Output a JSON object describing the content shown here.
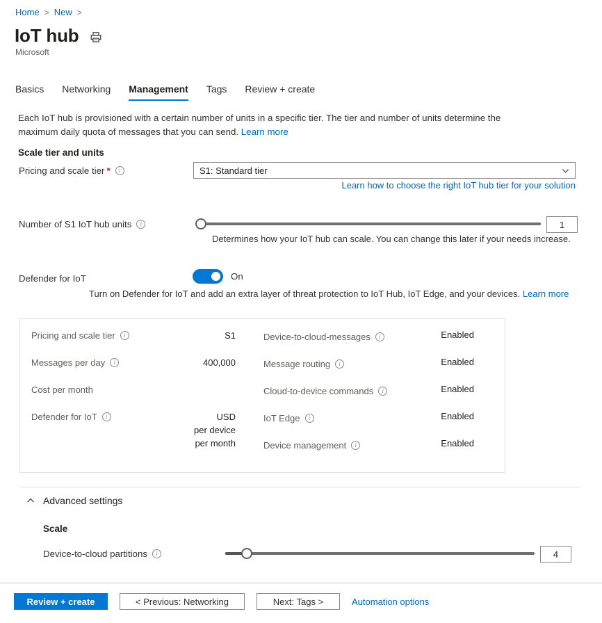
{
  "breadcrumb": {
    "items": [
      "Home",
      "New"
    ],
    "separator": ">"
  },
  "header": {
    "title": "IoT hub",
    "publisher": "Microsoft",
    "print_icon": "print-icon"
  },
  "tabs": [
    {
      "label": "Basics",
      "active": false
    },
    {
      "label": "Networking",
      "active": false
    },
    {
      "label": "Management",
      "active": true
    },
    {
      "label": "Tags",
      "active": false
    },
    {
      "label": "Review + create",
      "active": false
    }
  ],
  "intro": {
    "text": "Each IoT hub is provisioned with a certain number of units in a specific tier. The tier and number of units determine the maximum daily quota of messages that you can send. ",
    "link": "Learn more"
  },
  "scale_section": {
    "heading": "Scale tier and units",
    "pricing_tier": {
      "label": "Pricing and scale tier",
      "required_marker": "*",
      "info": "info-icon",
      "selected": "S1: Standard tier",
      "help_link": "Learn how to choose the right IoT hub tier for your solution"
    },
    "units": {
      "label": "Number of S1 IoT hub units",
      "info": "info-icon",
      "value": "1",
      "slider_percent": 0,
      "helper": "Determines how your IoT hub can scale. You can change this later if your needs increase."
    },
    "defender": {
      "label": "Defender for IoT",
      "state": "On",
      "enabled": true,
      "helper": "Turn on Defender for IoT and add an extra layer of threat protection to IoT Hub, IoT Edge, and your devices. ",
      "helper_link": "Learn more"
    }
  },
  "summary": {
    "left_rows": [
      {
        "label": "Pricing and scale tier",
        "info": "info-icon",
        "value": "S1"
      },
      {
        "label": "Messages per day",
        "info": "info-icon",
        "value": "400,000"
      },
      {
        "label": "Cost per month",
        "info": null,
        "value": ""
      },
      {
        "label": "Defender for IoT",
        "info": "info-icon",
        "value": "USD\nper device\nper month"
      }
    ],
    "right_rows": [
      {
        "label": "Device-to-cloud-messages",
        "info": "info-icon",
        "value": "Enabled"
      },
      {
        "label": "Message routing",
        "info": "info-icon",
        "value": "Enabled"
      },
      {
        "label": "Cloud-to-device commands",
        "info": "info-icon",
        "value": "Enabled"
      },
      {
        "label": "IoT Edge",
        "info": "info-icon",
        "value": "Enabled"
      },
      {
        "label": "Device management",
        "info": "info-icon",
        "value": "Enabled"
      }
    ]
  },
  "advanced": {
    "title": "Advanced settings",
    "expanded": true,
    "chevron": "chevron-up-icon",
    "scale_heading": "Scale",
    "partitions": {
      "label": "Device-to-cloud partitions",
      "info": "info-icon",
      "value": "4",
      "slider_percent": 7
    }
  },
  "footer": {
    "review_create": "Review + create",
    "previous": "< Previous: Networking",
    "next": "Next: Tags >",
    "automation": "Automation options"
  },
  "colors": {
    "accent": "#0078d4",
    "link": "#0067b8",
    "required": "#a4262c",
    "border": "#8a8886",
    "table_border": "#e1dfdd",
    "slider_track": "#707070"
  }
}
